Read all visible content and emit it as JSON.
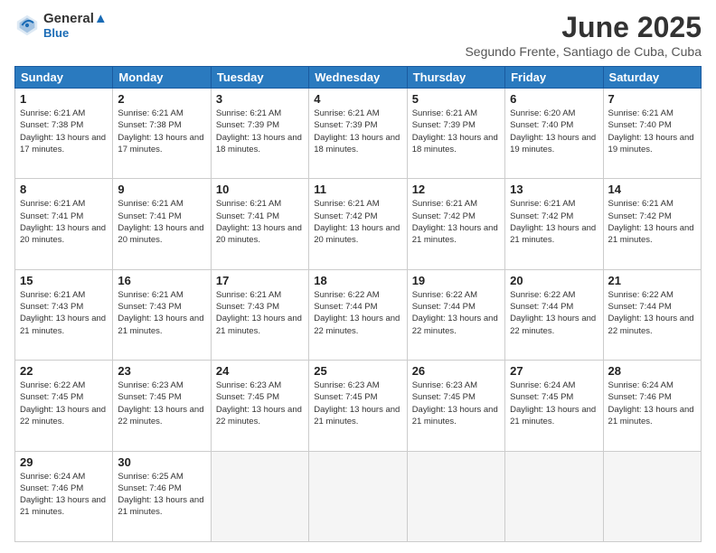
{
  "header": {
    "logo_line1": "General",
    "logo_line2": "Blue",
    "month": "June 2025",
    "location": "Segundo Frente, Santiago de Cuba, Cuba"
  },
  "days_of_week": [
    "Sunday",
    "Monday",
    "Tuesday",
    "Wednesday",
    "Thursday",
    "Friday",
    "Saturday"
  ],
  "weeks": [
    [
      {
        "day": 1,
        "sunrise": "6:21 AM",
        "sunset": "7:38 PM",
        "daylight": "13 hours and 17 minutes."
      },
      {
        "day": 2,
        "sunrise": "6:21 AM",
        "sunset": "7:38 PM",
        "daylight": "13 hours and 17 minutes."
      },
      {
        "day": 3,
        "sunrise": "6:21 AM",
        "sunset": "7:39 PM",
        "daylight": "13 hours and 18 minutes."
      },
      {
        "day": 4,
        "sunrise": "6:21 AM",
        "sunset": "7:39 PM",
        "daylight": "13 hours and 18 minutes."
      },
      {
        "day": 5,
        "sunrise": "6:21 AM",
        "sunset": "7:39 PM",
        "daylight": "13 hours and 18 minutes."
      },
      {
        "day": 6,
        "sunrise": "6:20 AM",
        "sunset": "7:40 PM",
        "daylight": "13 hours and 19 minutes."
      },
      {
        "day": 7,
        "sunrise": "6:21 AM",
        "sunset": "7:40 PM",
        "daylight": "13 hours and 19 minutes."
      }
    ],
    [
      {
        "day": 8,
        "sunrise": "6:21 AM",
        "sunset": "7:41 PM",
        "daylight": "13 hours and 20 minutes."
      },
      {
        "day": 9,
        "sunrise": "6:21 AM",
        "sunset": "7:41 PM",
        "daylight": "13 hours and 20 minutes."
      },
      {
        "day": 10,
        "sunrise": "6:21 AM",
        "sunset": "7:41 PM",
        "daylight": "13 hours and 20 minutes."
      },
      {
        "day": 11,
        "sunrise": "6:21 AM",
        "sunset": "7:42 PM",
        "daylight": "13 hours and 20 minutes."
      },
      {
        "day": 12,
        "sunrise": "6:21 AM",
        "sunset": "7:42 PM",
        "daylight": "13 hours and 21 minutes."
      },
      {
        "day": 13,
        "sunrise": "6:21 AM",
        "sunset": "7:42 PM",
        "daylight": "13 hours and 21 minutes."
      },
      {
        "day": 14,
        "sunrise": "6:21 AM",
        "sunset": "7:42 PM",
        "daylight": "13 hours and 21 minutes."
      }
    ],
    [
      {
        "day": 15,
        "sunrise": "6:21 AM",
        "sunset": "7:43 PM",
        "daylight": "13 hours and 21 minutes."
      },
      {
        "day": 16,
        "sunrise": "6:21 AM",
        "sunset": "7:43 PM",
        "daylight": "13 hours and 21 minutes."
      },
      {
        "day": 17,
        "sunrise": "6:21 AM",
        "sunset": "7:43 PM",
        "daylight": "13 hours and 21 minutes."
      },
      {
        "day": 18,
        "sunrise": "6:22 AM",
        "sunset": "7:44 PM",
        "daylight": "13 hours and 22 minutes."
      },
      {
        "day": 19,
        "sunrise": "6:22 AM",
        "sunset": "7:44 PM",
        "daylight": "13 hours and 22 minutes."
      },
      {
        "day": 20,
        "sunrise": "6:22 AM",
        "sunset": "7:44 PM",
        "daylight": "13 hours and 22 minutes."
      },
      {
        "day": 21,
        "sunrise": "6:22 AM",
        "sunset": "7:44 PM",
        "daylight": "13 hours and 22 minutes."
      }
    ],
    [
      {
        "day": 22,
        "sunrise": "6:22 AM",
        "sunset": "7:45 PM",
        "daylight": "13 hours and 22 minutes."
      },
      {
        "day": 23,
        "sunrise": "6:23 AM",
        "sunset": "7:45 PM",
        "daylight": "13 hours and 22 minutes."
      },
      {
        "day": 24,
        "sunrise": "6:23 AM",
        "sunset": "7:45 PM",
        "daylight": "13 hours and 22 minutes."
      },
      {
        "day": 25,
        "sunrise": "6:23 AM",
        "sunset": "7:45 PM",
        "daylight": "13 hours and 21 minutes."
      },
      {
        "day": 26,
        "sunrise": "6:23 AM",
        "sunset": "7:45 PM",
        "daylight": "13 hours and 21 minutes."
      },
      {
        "day": 27,
        "sunrise": "6:24 AM",
        "sunset": "7:45 PM",
        "daylight": "13 hours and 21 minutes."
      },
      {
        "day": 28,
        "sunrise": "6:24 AM",
        "sunset": "7:46 PM",
        "daylight": "13 hours and 21 minutes."
      }
    ],
    [
      {
        "day": 29,
        "sunrise": "6:24 AM",
        "sunset": "7:46 PM",
        "daylight": "13 hours and 21 minutes."
      },
      {
        "day": 30,
        "sunrise": "6:25 AM",
        "sunset": "7:46 PM",
        "daylight": "13 hours and 21 minutes."
      },
      null,
      null,
      null,
      null,
      null
    ]
  ]
}
